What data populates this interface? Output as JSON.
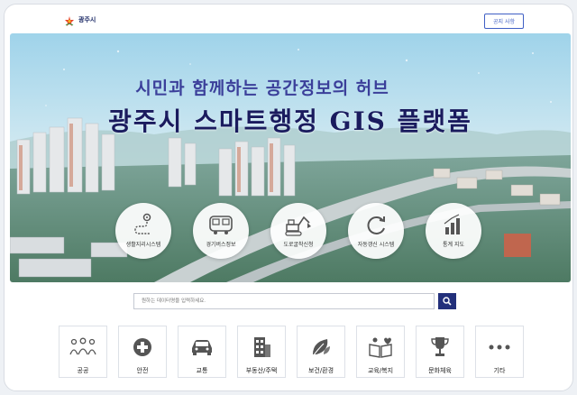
{
  "header": {
    "logo_text": "광주시",
    "notice_button": "공지 사항",
    "brand_colors": {
      "primary": "#23307b",
      "accent": "#3f5fc4"
    }
  },
  "hero": {
    "subtitle": "시민과 함께하는 공간정보의 허브",
    "title": "광주시 스마트행정 GIS 플랫폼",
    "services": [
      {
        "label": "생활지리시스템",
        "icon": "route-map-icon"
      },
      {
        "label": "경기버스정보",
        "icon": "bus-icon"
      },
      {
        "label": "도로굴착신청",
        "icon": "excavator-icon"
      },
      {
        "label": "자동갱신 시스템",
        "icon": "refresh-icon"
      },
      {
        "label": "통계 지도",
        "icon": "bar-chart-icon"
      }
    ]
  },
  "search": {
    "placeholder": "원하는 데이터명을 입력하세요."
  },
  "categories": [
    {
      "label": "공공",
      "icon": "people-group-icon"
    },
    {
      "label": "안전",
      "icon": "plus-circle-icon"
    },
    {
      "label": "교통",
      "icon": "car-icon"
    },
    {
      "label": "부동산/주택",
      "icon": "building-icon"
    },
    {
      "label": "보건/환경",
      "icon": "leaf-icon"
    },
    {
      "label": "교육/복지",
      "icon": "book-heart-icon"
    },
    {
      "label": "문화체육",
      "icon": "trophy-icon"
    },
    {
      "label": "기타",
      "icon": "more-dots-icon"
    }
  ]
}
